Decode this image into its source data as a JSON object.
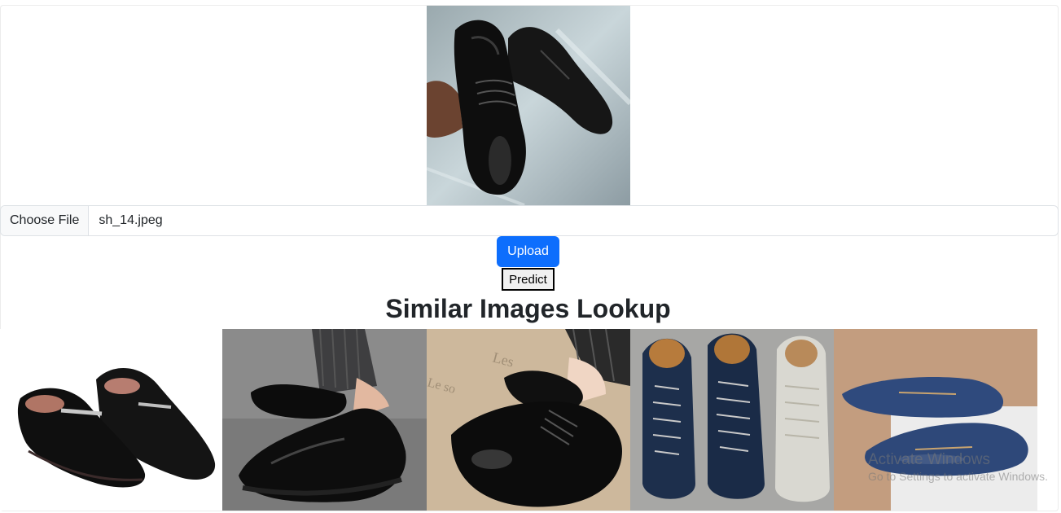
{
  "preview": {
    "image": "uploaded-shoe-photo"
  },
  "file_input": {
    "button_label": "Choose File",
    "file_name": "sh_14.jpeg"
  },
  "actions": {
    "upload_label": "Upload",
    "predict_label": "Predict"
  },
  "results": {
    "title": "Similar Images Lookup",
    "images": [
      {
        "name": "black-buckle-loafers"
      },
      {
        "name": "black-penny-loafers-worn"
      },
      {
        "name": "black-patent-lace-up"
      },
      {
        "name": "navy-and-grey-sneakers"
      },
      {
        "name": "blue-driving-moccasins"
      }
    ]
  },
  "watermark": {
    "title": "Activate Windows",
    "subtitle": "Go to Settings to activate Windows."
  },
  "colors": {
    "primary": "#0d6efd",
    "text": "#212529",
    "border": "#dee2e6"
  }
}
